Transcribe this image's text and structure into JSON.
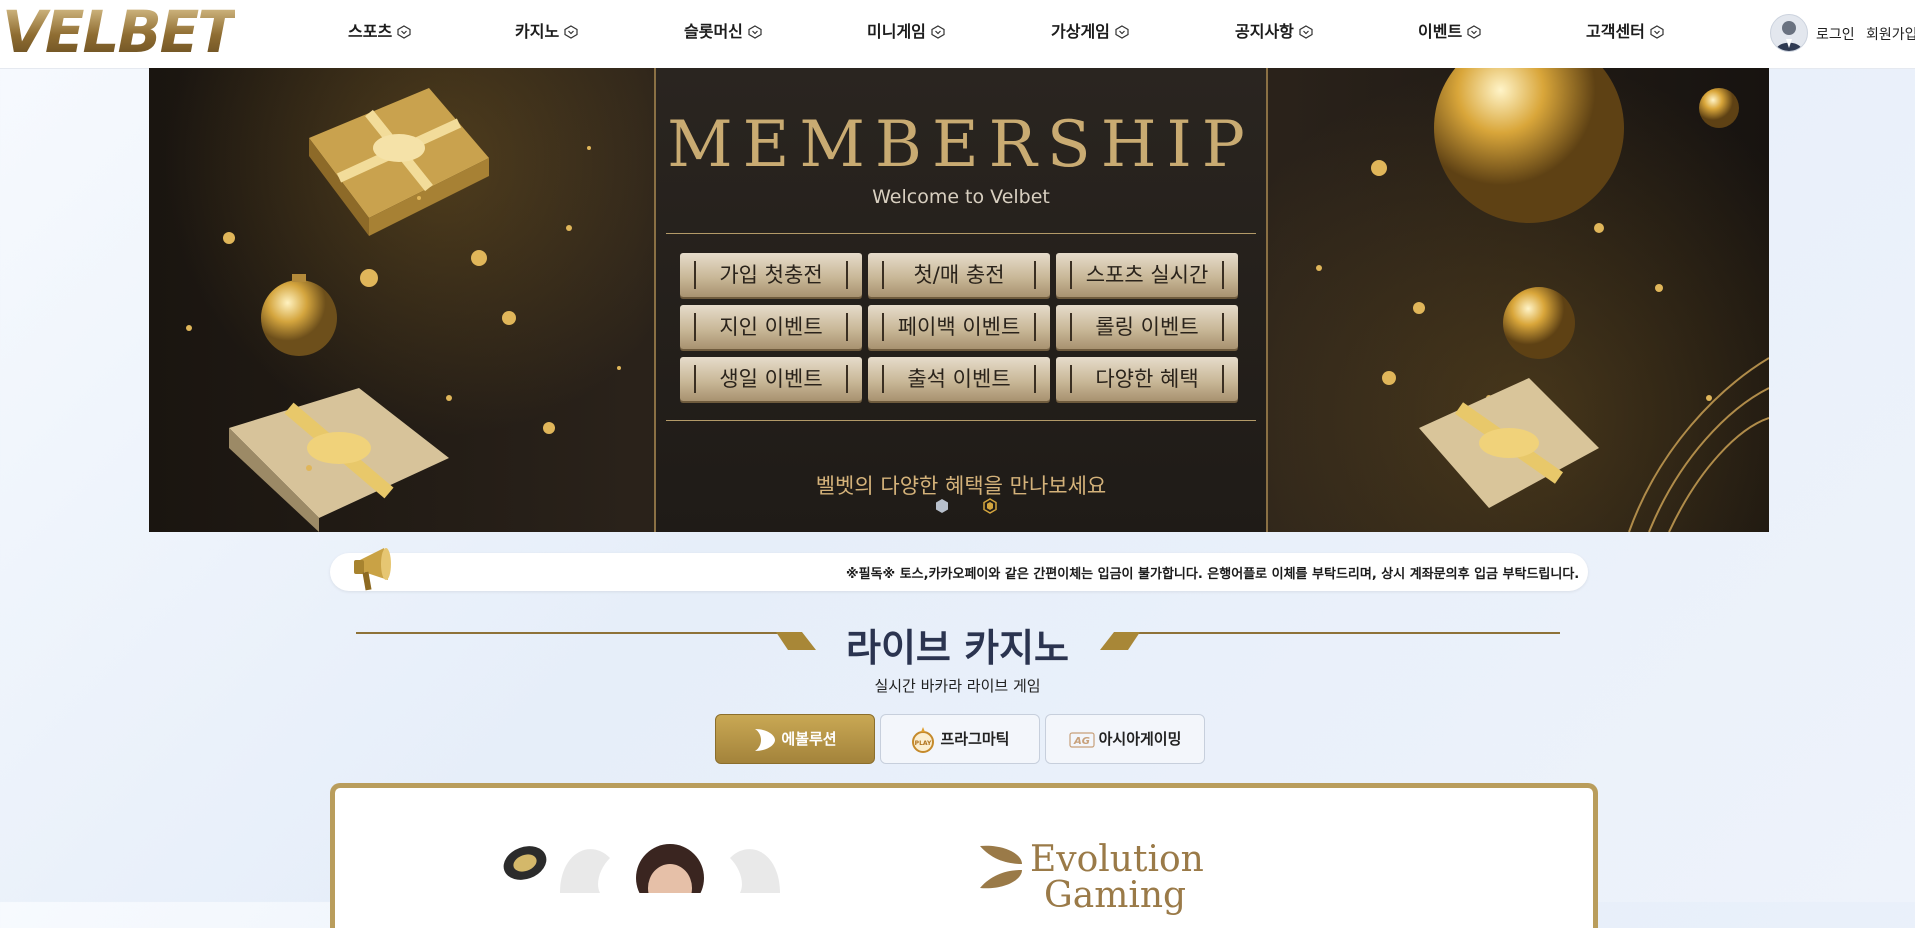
{
  "header": {
    "logo_text": "VELBET",
    "nav": [
      {
        "label": "스포츠"
      },
      {
        "label": "카지노"
      },
      {
        "label": "슬롯머신"
      },
      {
        "label": "미니게임"
      },
      {
        "label": "가상게임"
      },
      {
        "label": "공지사항"
      },
      {
        "label": "이벤트"
      },
      {
        "label": "고객센터"
      }
    ],
    "login_label": "로그인",
    "join_label": "회원가입"
  },
  "banner": {
    "title": "MEMBERSHIP",
    "subtitle": "Welcome to Velbet",
    "benefits": [
      "가입 첫충전",
      "첫/매 충전",
      "스포츠 실시간",
      "지인 이벤트",
      "페이백 이벤트",
      "롤링 이벤트",
      "생일 이벤트",
      "출석 이벤트",
      "다양한 혜택"
    ],
    "caption": "벨벳의 다양한 혜택을 만나보세요",
    "slide_count": 2,
    "active_slide": 2
  },
  "notice": {
    "text": "※필독※ 토스,카카오페이와 같은 간편이체는 입금이 불가합니다. 은행어플로 이체를 부탁드리며, 상시 계좌문의후 입금 부탁드립니다."
  },
  "section": {
    "title": "라이브 카지노",
    "subtitle": "실시간 바카라 라이브 게임",
    "tabs": [
      {
        "label": "에볼루션",
        "icon": "evolution-leaf-icon",
        "active": true
      },
      {
        "label": "프라그마틱",
        "icon": "pragmatic-play-icon",
        "active": false
      },
      {
        "label": "아시아게이밍",
        "icon": "ag-icon",
        "active": false
      }
    ]
  },
  "game_card": {
    "brand": "Evolution Gaming",
    "brand_line1": "Evolution",
    "brand_line2": "Gaming"
  },
  "colors": {
    "gold": "#b99d5c",
    "dark_gold": "#8e7238",
    "title_navy": "#2b3450",
    "banner_dark": "#1e1915"
  }
}
